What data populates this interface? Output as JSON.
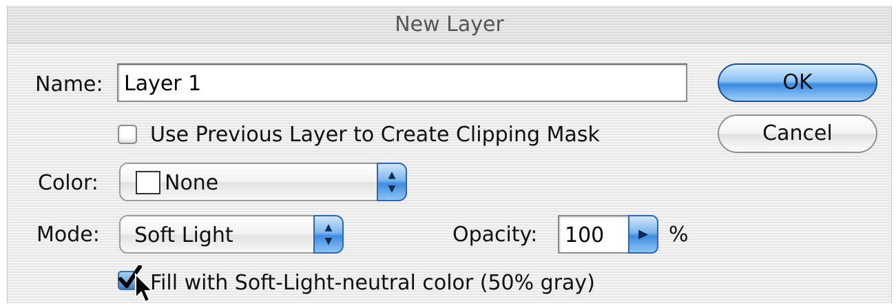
{
  "window": {
    "title": "New Layer"
  },
  "name_field": {
    "label": "Name:",
    "value": "Layer 1"
  },
  "clipping_mask": {
    "label": "Use Previous Layer to Create Clipping Mask",
    "checked": false
  },
  "color_select": {
    "label": "Color:",
    "value": "None",
    "swatch_color": "#ffffff"
  },
  "mode_select": {
    "label": "Mode:",
    "value": "Soft Light"
  },
  "opacity": {
    "label": "Opacity:",
    "value": "100",
    "unit": "%"
  },
  "fill_neutral": {
    "label": "Fill with Soft-Light-neutral color (50% gray)",
    "checked": true
  },
  "buttons": {
    "ok": "OK",
    "cancel": "Cancel"
  },
  "colors": {
    "accent": "#3d8ae0",
    "accent_border": "#1b4f9a",
    "stripe_light": "#f4f4f4",
    "stripe_dark": "#e6e6e6"
  },
  "icons": {
    "popup_arrows": "up-down-arrows-icon",
    "stepper": "right-triangle-icon",
    "checkmark": "checkmark-icon",
    "cursor": "arrow-cursor-icon"
  }
}
